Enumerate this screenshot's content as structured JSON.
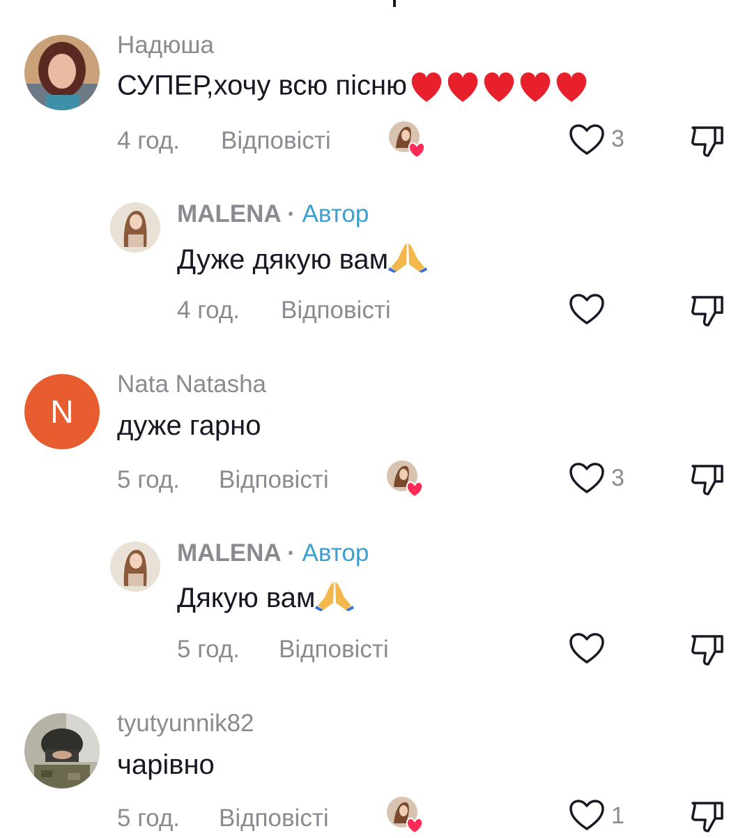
{
  "comments": [
    {
      "username": "Надюша",
      "text": "СУПЕР,хочу всю пісню",
      "emoji": "❤️❤️❤️❤️❤️",
      "time": "4 год.",
      "reply_label": "Відповісті",
      "likes": "3",
      "liked_by_creator": true
    },
    {
      "username": "MALENA",
      "separator": "·",
      "role": "Автор",
      "text": "Дуже дякую вам",
      "emoji": "🙏",
      "time": "4 год.",
      "reply_label": "Відповісті"
    },
    {
      "username": "Nata Natasha",
      "avatar_letter": "N",
      "text": "дуже гарно",
      "time": "5 год.",
      "reply_label": "Відповісті",
      "likes": "3",
      "liked_by_creator": true
    },
    {
      "username": "MALENA",
      "separator": "·",
      "role": "Автор",
      "text": "Дякую вам",
      "emoji": "🙏",
      "time": "5 год.",
      "reply_label": "Відповісті"
    },
    {
      "username": "tyutyunnik82",
      "text": "чарівно",
      "time": "5 год.",
      "reply_label": "Відповісті",
      "likes": "1",
      "liked_by_creator": true
    }
  ],
  "colors": {
    "author_label": "#3b9fcf",
    "muted": "#8a8b91",
    "heart_red": "#fe2c55",
    "letter_avatar_bg": "#e85d2f"
  },
  "icons": [
    "heart-outline-icon",
    "thumbs-down-icon",
    "creator-liked-badge-icon",
    "red-heart-emoji",
    "praying-hands-emoji"
  ]
}
